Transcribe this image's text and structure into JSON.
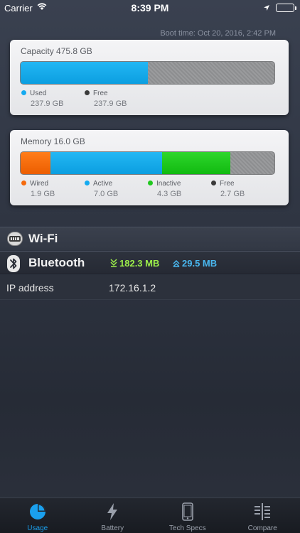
{
  "status_bar": {
    "carrier": "Carrier",
    "time": "8:39 PM"
  },
  "boot_time": "Boot time: Oct 20, 2016, 2:42 PM",
  "capacity": {
    "title": "Capacity 475.8 GB",
    "segments": [
      {
        "name": "Used",
        "value": "237.9 GB",
        "fraction": 0.5,
        "color": "#14aaf0"
      },
      {
        "name": "Free",
        "value": "237.9 GB",
        "fraction": 0.5,
        "color": "#8d8e90"
      }
    ],
    "legend": [
      {
        "label": "Used",
        "value": "237.9 GB",
        "dot_color": "#14aaf0"
      },
      {
        "label": "Free",
        "value": "237.9 GB",
        "dot_color": "#3a3a3a"
      }
    ]
  },
  "memory": {
    "title": "Memory 16.0 GB",
    "segments": [
      {
        "name": "Wired",
        "fraction": 0.119,
        "color": "#f56a0c"
      },
      {
        "name": "Active",
        "fraction": 0.4375,
        "color": "#14aaf0"
      },
      {
        "name": "Inactive",
        "fraction": 0.269,
        "color": "#20c81e"
      },
      {
        "name": "Free",
        "fraction": 0.169,
        "color": "#8d8e90"
      }
    ],
    "legend": [
      {
        "label": "Wired",
        "value": "1.9 GB",
        "dot_color": "#f56a0c"
      },
      {
        "label": "Active",
        "value": "7.0 GB",
        "dot_color": "#14aaf0"
      },
      {
        "label": "Inactive",
        "value": "4.3 GB",
        "dot_color": "#20c81e"
      },
      {
        "label": "Free",
        "value": "2.7 GB",
        "dot_color": "#3a3a3a"
      }
    ]
  },
  "wifi": {
    "title": "Wi-Fi"
  },
  "bluetooth": {
    "title": "Bluetooth",
    "download": "182.3 MB",
    "upload": "29.5 MB"
  },
  "ip": {
    "label": "IP address",
    "value": "172.16.1.2"
  },
  "tabs": [
    {
      "label": "Usage",
      "icon": "pie-chart-icon",
      "active": true
    },
    {
      "label": "Battery",
      "icon": "lightning-icon",
      "active": false
    },
    {
      "label": "Tech Specs",
      "icon": "phone-icon",
      "active": false
    },
    {
      "label": "Compare",
      "icon": "compare-icon",
      "active": false
    }
  ]
}
